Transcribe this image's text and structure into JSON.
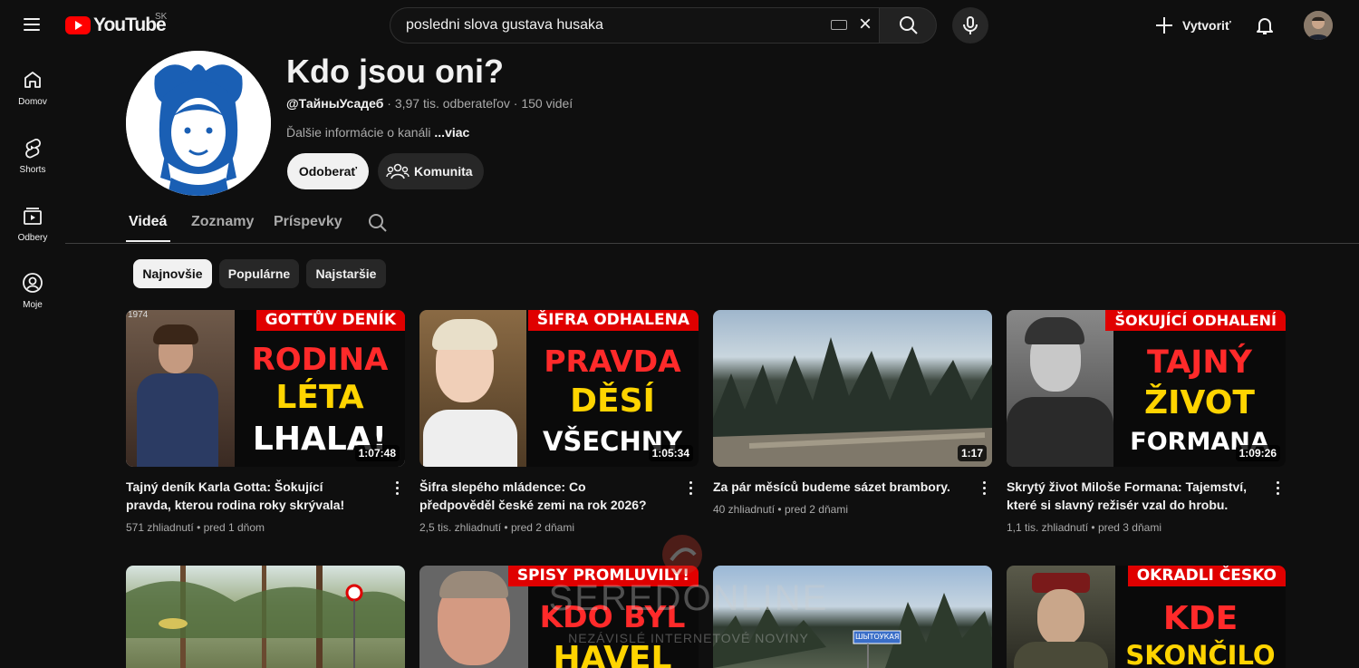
{
  "header": {
    "logo_text": "YouTube",
    "country": "SK",
    "search_value": "posledni slova gustava husaka",
    "create_label": "Vytvoriť"
  },
  "nav": [
    {
      "label": "Domov",
      "icon": "home-icon"
    },
    {
      "label": "Shorts",
      "icon": "shorts-icon"
    },
    {
      "label": "Odbery",
      "icon": "subscriptions-icon"
    },
    {
      "label": "Moje",
      "icon": "you-icon"
    }
  ],
  "channel": {
    "title": "Kdo jsou oni?",
    "handle": "@ТайныУсадеб",
    "subscribers": "3,97 tis. odberateľov",
    "videos_count": "150 videí",
    "meta_sep": " · ",
    "description": "Ďalšie informácie o kanáli ",
    "more_label": "...viac",
    "subscribe_label": "Odoberať",
    "community_label": "Komunita"
  },
  "tabs": [
    {
      "label": "Videá",
      "active": true
    },
    {
      "label": "Zoznamy",
      "active": false
    },
    {
      "label": "Príspevky",
      "active": false
    }
  ],
  "chips": [
    {
      "label": "Najnovšie",
      "active": true
    },
    {
      "label": "Populárne",
      "active": false
    },
    {
      "label": "Najstaršie",
      "active": false
    }
  ],
  "videos": [
    {
      "banner": "GOTTŮV DENÍK",
      "lines": [
        "RODINA",
        "LÉTA",
        "LHALA!"
      ],
      "line_colors": [
        "#ff2a2a",
        "#ffd400",
        "#ffffff"
      ],
      "stamp": "1974",
      "duration": "1:07:48",
      "title": "Tajný deník Karla Gotta: Šokující pravda, kterou rodina roky skrývala!",
      "views": "571 zhliadnutí",
      "age": "pred 1 dňom"
    },
    {
      "banner": "ŠIFRA ODHALENA",
      "lines": [
        "PRAVDA",
        "DĚSÍ",
        "VŠECHNY"
      ],
      "line_colors": [
        "#ff2a2a",
        "#ffd400",
        "#ffffff"
      ],
      "duration": "1:05:34",
      "title": "Šifra slepého mládence: Co předpověděl české zemi na rok 2026?",
      "views": "2,5 tis. zhliadnutí",
      "age": "pred 2 dňami"
    },
    {
      "duration": "1:17",
      "title": "Za pár měsíců budeme sázet brambory.",
      "views": "40 zhliadnutí",
      "age": "pred 2 dňami"
    },
    {
      "banner": "ŠOKUJÍCÍ ODHALENÍ",
      "lines": [
        "TAJNÝ",
        "ŽIVOT",
        "FORMANA"
      ],
      "line_colors": [
        "#ff2a2a",
        "#ffd400",
        "#ffffff"
      ],
      "duration": "1:09:26",
      "title": "Skrytý život Miloše Formana: Tajemství, které si slavný režisér vzal do hrobu.",
      "views": "1,1 tis. zhliadnutí",
      "age": "pred 3 dňami"
    },
    {},
    {
      "banner": "SPISY PROMLUVILY!",
      "lines": [
        "KDO BYL",
        "HAVEL"
      ],
      "line_colors": [
        "#ff2a2a",
        "#ffd400"
      ]
    },
    {
      "sign": "ШЫТОУКАЯ"
    },
    {
      "banner": "OKRADLI ČESKO",
      "lines": [
        "KDE",
        "SKONČILO"
      ],
      "line_colors": [
        "#ff2a2a",
        "#ffd400"
      ]
    }
  ],
  "watermark": {
    "name": "SEREDONLINE",
    "tagline": "NEZÁVISLÉ INTERNETOVÉ NOVINY"
  },
  "colors": {
    "background": "#0f0f0f",
    "brand_red": "#ff0000",
    "chip_bg": "#272727"
  }
}
